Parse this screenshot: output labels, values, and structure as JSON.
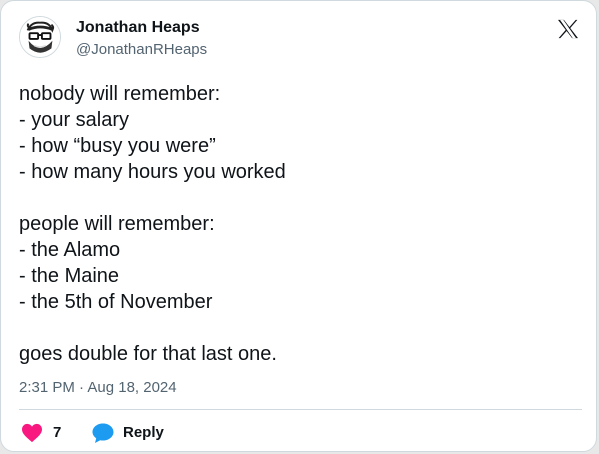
{
  "author": {
    "display_name": "Jonathan Heaps",
    "handle": "@JonathanRHeaps"
  },
  "post": {
    "lines": [
      "nobody will remember:",
      "- your salary",
      "- how “busy you were”",
      "- how many hours you worked",
      "",
      "people will remember:",
      "- the Alamo",
      "- the Maine",
      "- the 5th of November",
      "",
      "goes double for that last one."
    ],
    "timestamp": "2:31 PM · Aug 18, 2024"
  },
  "actions": {
    "like_count": "7",
    "reply_label": "Reply"
  },
  "icons": {
    "platform": "x-logo-icon",
    "like": "heart-icon",
    "reply": "speech-bubble-icon"
  },
  "colors": {
    "text_primary": "#0f1419",
    "text_secondary": "#536471",
    "like_pink": "#f91880",
    "reply_blue": "#1d9bf0",
    "border": "#cfd9de"
  }
}
